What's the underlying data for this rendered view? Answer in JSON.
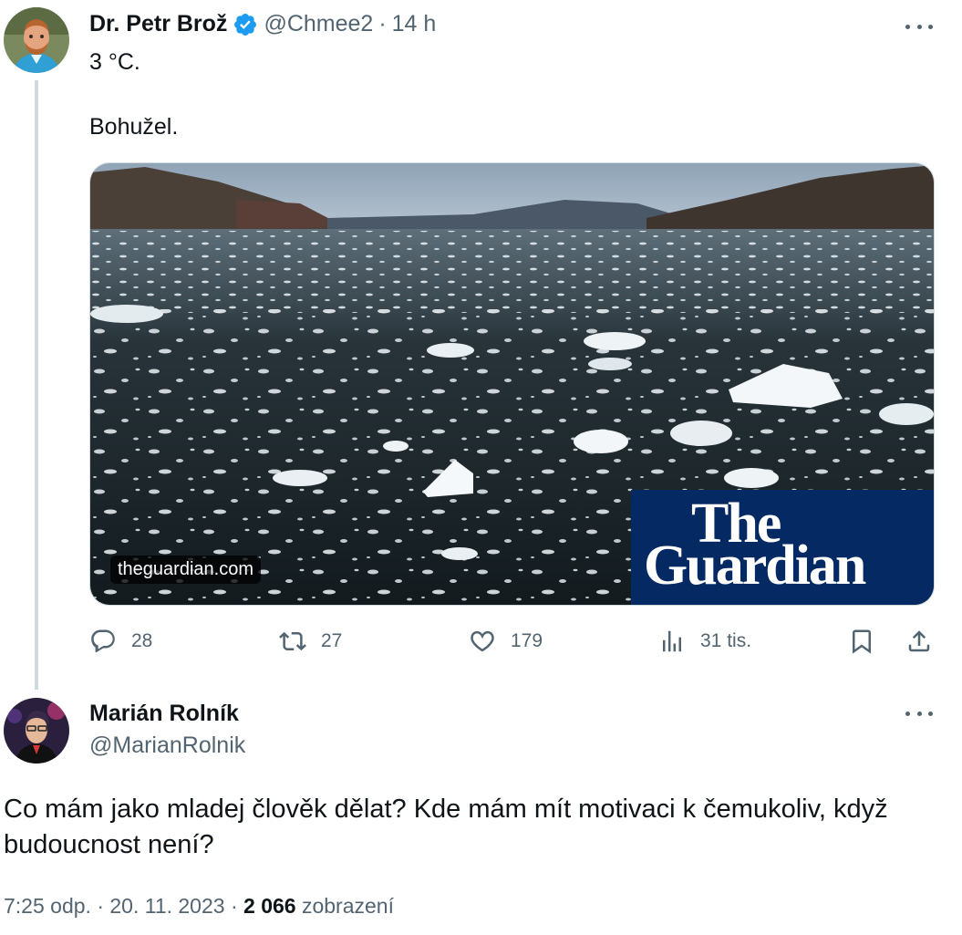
{
  "tweet": {
    "author_name": "Dr. Petr Brož",
    "handle": "@Chmee2",
    "separator": "·",
    "time": "14 h",
    "verified_icon": "verified-badge-icon",
    "text_line1": "3 °C.",
    "text_line2": "Bohužel.",
    "media": {
      "domain": "theguardian.com",
      "logo_line1": "The",
      "logo_line2": "Guardian"
    },
    "actions": {
      "replies": "28",
      "retweets": "27",
      "likes": "179",
      "views": "31 tis."
    }
  },
  "reply": {
    "author_name": "Marián Rolník",
    "handle": "@MarianRolnik",
    "text": "Co mám jako mladej člověk dělat? Kde mám mít motivaci k čemukoliv, když budoucnost není?",
    "time": "7:25 odp.",
    "date": "20. 11. 2023",
    "separator": "·",
    "views_count": "2 066",
    "views_label": "zobrazení"
  },
  "colors": {
    "text_primary": "#0f1419",
    "text_secondary": "#536471",
    "verified_blue": "#1d9bf0",
    "guardian_blue": "#052962",
    "thread_line": "#cfd9de"
  }
}
